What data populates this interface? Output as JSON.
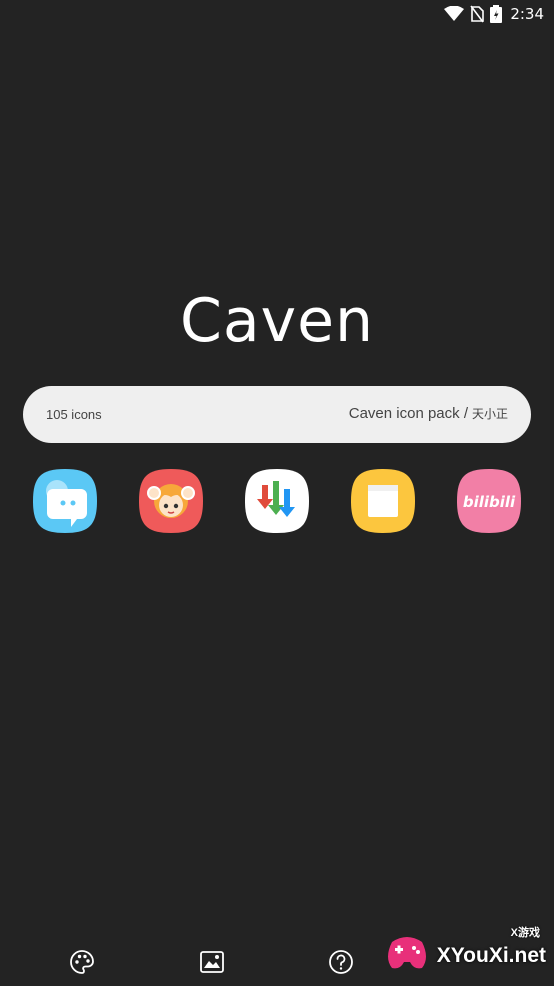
{
  "status_bar": {
    "time": "2:34",
    "icons": [
      "wifi-icon",
      "no-sim-icon",
      "battery-icon"
    ]
  },
  "title": "Caven",
  "info_pill": {
    "count": "105 icons",
    "pack_name": "Caven icon pack / ",
    "author": "天小正"
  },
  "preview_icons": [
    {
      "name": "chat-bubble-app-icon",
      "bg": "#5bc8f5"
    },
    {
      "name": "anime-girl-app-icon",
      "bg": "#ef5a5a"
    },
    {
      "name": "download-arrows-app-icon",
      "bg": "#ffffff"
    },
    {
      "name": "notes-app-icon",
      "bg": "#fcc63e"
    },
    {
      "name": "bilibili-app-icon",
      "bg": "#f27fa6",
      "label": "bilibili"
    }
  ],
  "bottom_nav": [
    "palette-icon",
    "wallpaper-icon",
    "help-icon"
  ],
  "watermark": {
    "brand": "XYouXi.net",
    "small": "X游戏"
  }
}
